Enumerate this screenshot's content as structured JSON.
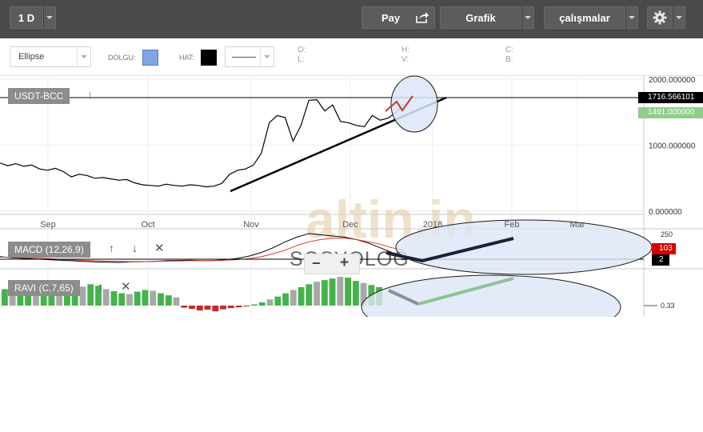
{
  "topbar": {
    "interval_label": "1 D",
    "pay_label": "Pay",
    "chart_label": "Grafik",
    "studies_label": "çalışmalar"
  },
  "drawing_toolbar": {
    "shape_value": "Ellipse",
    "fill_label": "DOLGU:",
    "line_label": "HAT:",
    "fill_color": "#7ea6e6",
    "line_color": "#000000",
    "ohlc": {
      "o": "O:",
      "h": "H:",
      "c": "C:",
      "l": "L:",
      "v": "V:",
      "b": "B:"
    }
  },
  "watermark": {
    "logo_text": "altin.in",
    "sub_text": "SOSYOLOG"
  },
  "zoom": {
    "minus": "−",
    "plus": "+"
  },
  "colors": {
    "price_line": "#000000",
    "macd_line": "#000000",
    "signal_line": "#d23a2a",
    "ravi_up": "#43b34a",
    "ravi_neutral": "#a8a8a8",
    "ravi_down": "#c52a2a",
    "ellipse_fill": "#dce6f7",
    "ellipse_stroke": "#1a1a1a",
    "tag_current": "#000000",
    "tag_green": "#8fce8a",
    "tag_red": "#d60000"
  },
  "chart_data": [
    {
      "type": "line",
      "pane": "price",
      "title": "USDT-BCC",
      "x": [
        "Sep",
        "Oct",
        "Nov",
        "Dec",
        "2018",
        "Feb",
        "Mar"
      ],
      "y_ticks": [
        "2000.000000",
        "1000.000000",
        "0.000000"
      ],
      "ylim": [
        0,
        2000
      ],
      "price_tags": [
        "1716.566101",
        "1491.000000"
      ],
      "series": [
        {
          "values": [
            730,
            690,
            720,
            680,
            700,
            640,
            620,
            650,
            600,
            520,
            560,
            540,
            500,
            510,
            490,
            470,
            480,
            430,
            400,
            390,
            380,
            410,
            390,
            380,
            400,
            390,
            370,
            380,
            420,
            560,
            620,
            640,
            700,
            880,
            1340,
            1450,
            1420,
            1060,
            1300,
            1680,
            1690,
            1520,
            1610,
            1360,
            1340,
            1300,
            1280,
            1450,
            1380,
            1410,
            1500,
            1620
          ]
        }
      ]
    },
    {
      "type": "line",
      "pane": "macd",
      "title": "MACD (12,26,9)",
      "y_ticks": [
        "250"
      ],
      "tags": [
        "103",
        "2"
      ],
      "series": [
        {
          "values": [
            5,
            -5,
            -10,
            -15,
            -20,
            -25,
            -30,
            -35,
            -40,
            -42,
            -44,
            -40,
            -38,
            -35,
            -30,
            -28,
            -25,
            -30,
            -28,
            -20,
            -10,
            10,
            40,
            80,
            130,
            170,
            200,
            190,
            180,
            170,
            150,
            120,
            80,
            40,
            10
          ]
        },
        {
          "values": [
            0,
            0,
            -5,
            -8,
            -12,
            -18,
            -22,
            -26,
            -30,
            -34,
            -36,
            -38,
            -38,
            -36,
            -34,
            -32,
            -30,
            -30,
            -29,
            -26,
            -20,
            -12,
            4,
            30,
            60,
            100,
            130,
            150,
            160,
            162,
            150,
            130,
            110,
            80,
            60
          ]
        }
      ]
    },
    {
      "type": "bar",
      "pane": "ravi",
      "title": "RAVI (C,7,65)",
      "y_ticks": [
        "0.33"
      ],
      "values": [
        40,
        45,
        35,
        50,
        42,
        38,
        48,
        44,
        36,
        30,
        46,
        52,
        48,
        40,
        35,
        30,
        28,
        34,
        38,
        36,
        30,
        25,
        20,
        -5,
        -8,
        -12,
        -10,
        -14,
        -9,
        -6,
        -4,
        -2,
        3,
        8,
        15,
        22,
        30,
        38,
        45,
        52,
        58,
        62,
        66,
        70,
        68,
        60,
        55,
        50,
        45
      ]
    }
  ]
}
